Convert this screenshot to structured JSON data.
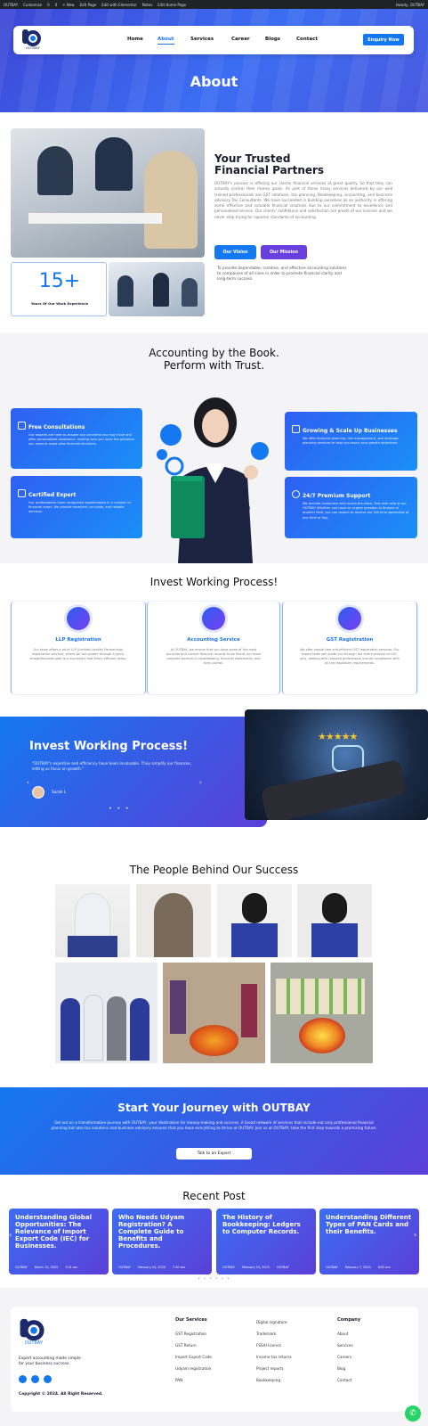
{
  "wp_bar": {
    "items": [
      "OUTBAY",
      "Customize",
      "0",
      "0",
      "+ New",
      "Edit Page",
      "Edit with Elementor",
      "Notes",
      "Edit Home Page"
    ],
    "right": "Howdy, OUTBAY"
  },
  "nav": {
    "logo_text": "OUTBAY",
    "items": [
      "Home",
      "About",
      "Services",
      "Career",
      "Blogs",
      "Contact"
    ],
    "cta": "Enquiry Now"
  },
  "hero": {
    "title": "About"
  },
  "about": {
    "heading_line1": "Your Trusted",
    "heading_line2": "Financial Partners",
    "body": "OUTBAY's passion is offering our clients financial services of great quality. So that they can actually control their money goals. As part of these many services delivered by our well trained professionals are GST solutions, tax planning, Bookkeeping, accounting, and business advisory Tax Consultants. We have succeeded in building ourselves as an authority in offering some effective and valuable financial solutions due to our commitment to excellence and personalised service. Our clients' confidence and satisfaction are proofs of our success and we never stop trying for superior standards of accounting.",
    "tab_vision": "Our Vision",
    "tab_mission": "Our Mission",
    "tab_text": "To provide dependable, creative, and effective accounting solutions to companies of all sizes in order to promote financial clarity and long-term success.",
    "years": "15+",
    "years_label": "Years Of Our Work Experience"
  },
  "book": {
    "heading_line1": "Accounting by the Book.",
    "heading_line2": "Perform with Trust.",
    "cards": [
      {
        "title": "Free Consultations",
        "text": "Our experts are here to answer any concerns you may have and offer personalized assistance, making sure you have the guidance you need to make wise financial decisions."
      },
      {
        "title": "Certified Expert",
        "text": "Our professionals have recognized qualifications in a number of financial areas. We provide excellent, accurate, and reliable services."
      },
      {
        "title": "Growing & Scale Up Businesses",
        "text": "We offer financial planning, risk management, and strategic planning services to help you reach your growth objectives."
      },
      {
        "title": "24/7 Premium Support",
        "text": "We provide customers with round-the-clock, first-rate help at our OUTBAY. Whether you have an urgent question in finance or another field, you can expect to receive our full-time specialists at any time of day."
      }
    ]
  },
  "process": {
    "heading": "Invest Working Process!",
    "cards": [
      {
        "title": "LLP Registration",
        "text": "Our team offers a bit of LLP (Limited Liability Partnership) registration services, where we are guided through a quick, straightforward path to a successful and firmly efficient setup."
      },
      {
        "title": "Accounting Service",
        "text": "At OUTBAY, we ensure that you have some of the most accurate and current financial records to be found; our team provides services in bookkeeping, financial statements, and even payroll."
      },
      {
        "title": "GST Registration",
        "text": "We offer hassle-free and efficient GST registration services. Our expert team will guide you through the entire process of GST, only, dealing with required professional ensure compliance with all the regulatory requirements."
      }
    ]
  },
  "testimonial": {
    "heading": "Invest Working Process!",
    "quote": "\"OUTBAY's expertise and efficiency have been invaluable. They simplify our finances, letting us focus on growth.\"",
    "author": "Sarah L"
  },
  "team": {
    "heading": "The People Behind Our Success"
  },
  "journey": {
    "heading": "Start Your Journey with OUTBAY",
    "text": "Set out on a transformative journey with OUTBAY, your destination for money-making and success. A broad network of services that include not only professional financial planning but also tax solutions and business advisory ensures that you have everything to thrive at OUTBAY. Join us at OUTBAY; take the first step towards a promising future.",
    "cta": "Talk to an Expert"
  },
  "posts": {
    "heading": "Recent Post",
    "items": [
      {
        "title": "Understanding Global Opportunities: The Relevance of Import Export Code (IEC) for Businesses.",
        "author": "OUTBAY",
        "date": "March 13, 2025",
        "time": "3:01 am"
      },
      {
        "title": "Who Needs Udyam Registration? A Complete Guide to Benefits and Procedures.",
        "author": "OUTBAY",
        "date": "February 24, 2025",
        "time": "7:30 am"
      },
      {
        "title": "The History of Bookkeeping: Ledgers to Computer Records.",
        "author": "OUTBAY",
        "date": "February 10, 2025",
        "time": "OUTBAY"
      },
      {
        "title": "Understanding Different Types of PAN Cards and their Benefits.",
        "author": "OUTBAY",
        "date": "February 7, 2025",
        "time": "8:00 am"
      }
    ]
  },
  "footer": {
    "tagline_line1": "Expert accounting made simple",
    "tagline_line2": "for your business success.",
    "copyright": "Copyright © 2024. All Right Reserved.",
    "services_title": "Our Services",
    "services": [
      "GST Registration",
      "GST Return",
      "Import Export Code",
      "Udyam registration",
      "PAN"
    ],
    "services2": [
      "Digital signature",
      "Trademark",
      "FSSAI licence",
      "Income tax returns",
      "Project reports",
      "Bookkeeping"
    ],
    "company_title": "Company",
    "company": [
      "About",
      "Services",
      "Careers",
      "Blog",
      "Contact"
    ]
  },
  "colors": {
    "accent": "#1478f0",
    "purple": "#5b3fd8",
    "whatsapp": "#25d366"
  }
}
